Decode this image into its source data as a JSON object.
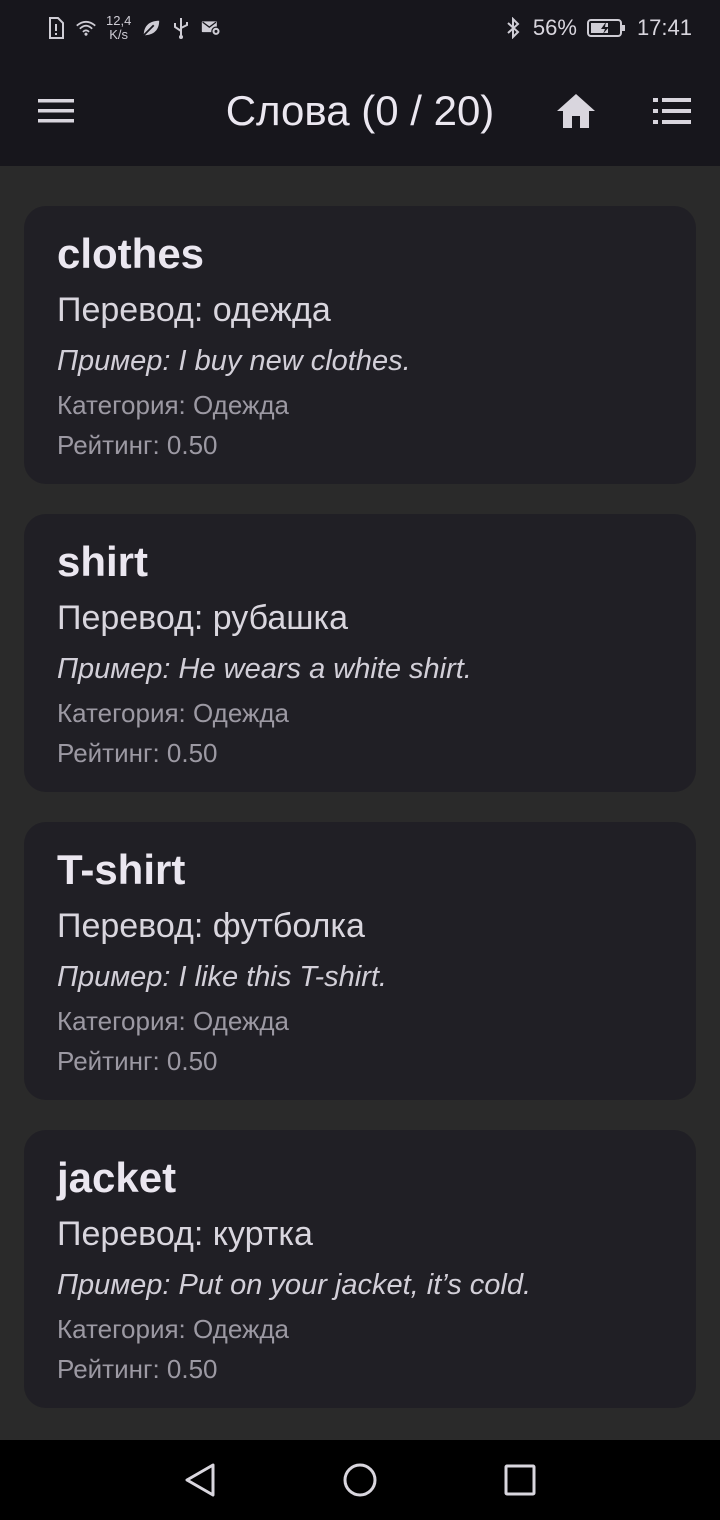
{
  "status_bar": {
    "speed_value": "12,4",
    "speed_unit": "K/s",
    "battery": "56%",
    "time": "17:41",
    "icons": [
      "sim-icon",
      "wifi-icon",
      "leaf-icon",
      "usb-icon",
      "mail-settings-icon",
      "bluetooth-icon",
      "battery-charging-icon"
    ]
  },
  "app_bar": {
    "title": "Слова (0 / 20)",
    "icons": [
      "hamburger-menu-icon",
      "home-icon",
      "list-icon"
    ]
  },
  "cards": [
    {
      "word": "clothes",
      "translation": "Перевод: одежда",
      "example_label": "Пример",
      "example_text": ": I buy new clothes.",
      "category": "Категория: Одежда",
      "rating": "Рейтинг: 0.50"
    },
    {
      "word": "shirt",
      "translation": "Перевод: рубашка",
      "example_label": "Пример",
      "example_text": ": He wears a white shirt.",
      "category": "Категория: Одежда",
      "rating": "Рейтинг: 0.50"
    },
    {
      "word": "T-shirt",
      "translation": "Перевод: футболка",
      "example_label": "Пример",
      "example_text": ": I like this T-shirt.",
      "category": "Категория: Одежда",
      "rating": "Рейтинг: 0.50"
    },
    {
      "word": "jacket",
      "translation": "Перевод: куртка",
      "example_label": "Пример",
      "example_text": ": Put on your jacket, it’s cold.",
      "category": "Категория: Одежда",
      "rating": "Рейтинг: 0.50"
    }
  ],
  "nav_bar": {
    "icons": [
      "back-icon",
      "home-circle-icon",
      "recents-icon"
    ]
  },
  "colors": {
    "background": "#2a2a2a",
    "app_bar": "#17161c",
    "card": "#201f25",
    "primary_text": "#ebe7f0",
    "secondary_text": "#9c99a3"
  }
}
